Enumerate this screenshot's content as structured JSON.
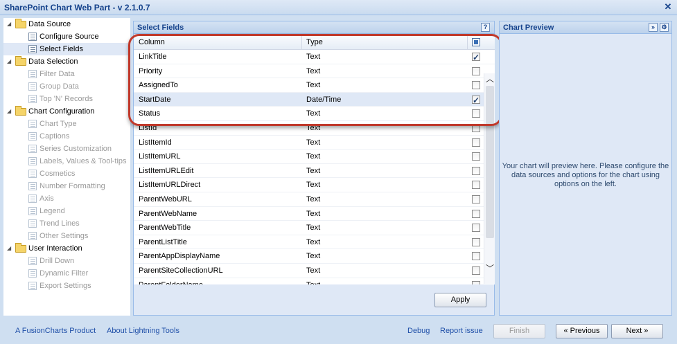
{
  "window": {
    "title": "SharePoint Chart Web Part - v 2.1.0.7"
  },
  "tree": {
    "items": [
      {
        "label": "Data Source",
        "type": "folder",
        "expanded": true,
        "disabled": false,
        "selected": false
      },
      {
        "label": "Configure Source",
        "type": "child",
        "disabled": false,
        "selected": false
      },
      {
        "label": "Select Fields",
        "type": "child",
        "disabled": false,
        "selected": true
      },
      {
        "label": "Data Selection",
        "type": "folder",
        "expanded": true,
        "disabled": false,
        "selected": false
      },
      {
        "label": "Filter Data",
        "type": "child",
        "disabled": true,
        "selected": false
      },
      {
        "label": "Group Data",
        "type": "child",
        "disabled": true,
        "selected": false
      },
      {
        "label": "Top 'N' Records",
        "type": "child",
        "disabled": true,
        "selected": false
      },
      {
        "label": "Chart Configuration",
        "type": "folder",
        "expanded": true,
        "disabled": false,
        "selected": false
      },
      {
        "label": "Chart Type",
        "type": "child",
        "disabled": true,
        "selected": false
      },
      {
        "label": "Captions",
        "type": "child",
        "disabled": true,
        "selected": false
      },
      {
        "label": "Series Customization",
        "type": "child",
        "disabled": true,
        "selected": false
      },
      {
        "label": "Labels, Values & Tool-tips",
        "type": "child",
        "disabled": true,
        "selected": false
      },
      {
        "label": "Cosmetics",
        "type": "child",
        "disabled": true,
        "selected": false
      },
      {
        "label": "Number Formatting",
        "type": "child",
        "disabled": true,
        "selected": false
      },
      {
        "label": "Axis",
        "type": "child",
        "disabled": true,
        "selected": false
      },
      {
        "label": "Legend",
        "type": "child",
        "disabled": true,
        "selected": false
      },
      {
        "label": "Trend Lines",
        "type": "child",
        "disabled": true,
        "selected": false
      },
      {
        "label": "Other Settings",
        "type": "child",
        "disabled": true,
        "selected": false
      },
      {
        "label": "User Interaction",
        "type": "folder",
        "expanded": true,
        "disabled": false,
        "selected": false
      },
      {
        "label": "Drill Down",
        "type": "child",
        "disabled": true,
        "selected": false
      },
      {
        "label": "Dynamic Filter",
        "type": "child",
        "disabled": true,
        "selected": false
      },
      {
        "label": "Export Settings",
        "type": "child",
        "disabled": true,
        "selected": false
      }
    ]
  },
  "select_fields": {
    "title": "Select Fields",
    "help_label": "?",
    "columns": {
      "column": "Column",
      "type": "Type"
    },
    "rows": [
      {
        "column": "LinkTitle",
        "type": "Text",
        "checked": true,
        "selected": false
      },
      {
        "column": "Priority",
        "type": "Text",
        "checked": false,
        "selected": false
      },
      {
        "column": "AssignedTo",
        "type": "Text",
        "checked": false,
        "selected": false
      },
      {
        "column": "StartDate",
        "type": "Date/Time",
        "checked": true,
        "selected": true
      },
      {
        "column": "Status",
        "type": "Text",
        "checked": false,
        "selected": false
      },
      {
        "column": "ListId",
        "type": "Text",
        "checked": false,
        "selected": false
      },
      {
        "column": "ListItemId",
        "type": "Text",
        "checked": false,
        "selected": false
      },
      {
        "column": "ListItemURL",
        "type": "Text",
        "checked": false,
        "selected": false
      },
      {
        "column": "ListItemURLEdit",
        "type": "Text",
        "checked": false,
        "selected": false
      },
      {
        "column": "ListItemURLDirect",
        "type": "Text",
        "checked": false,
        "selected": false
      },
      {
        "column": "ParentWebURL",
        "type": "Text",
        "checked": false,
        "selected": false
      },
      {
        "column": "ParentWebName",
        "type": "Text",
        "checked": false,
        "selected": false
      },
      {
        "column": "ParentWebTitle",
        "type": "Text",
        "checked": false,
        "selected": false
      },
      {
        "column": "ParentListTitle",
        "type": "Text",
        "checked": false,
        "selected": false
      },
      {
        "column": "ParentAppDisplayName",
        "type": "Text",
        "checked": false,
        "selected": false
      },
      {
        "column": "ParentSiteCollectionURL",
        "type": "Text",
        "checked": false,
        "selected": false
      },
      {
        "column": "ParentFolderName",
        "type": "Text",
        "checked": false,
        "selected": false
      }
    ],
    "apply_label": "Apply"
  },
  "chart_preview": {
    "title": "Chart Preview",
    "message": "Your chart will preview here. Please configure the data sources and options for the chart using options on the left."
  },
  "footer": {
    "fusioncharts_link": "A FusionCharts Product",
    "about_link": "About Lightning Tools",
    "debug_link": "Debug",
    "report_link": "Report issue",
    "finish_label": "Finish",
    "previous_label": "« Previous",
    "next_label": "Next »"
  },
  "colors": {
    "accent": "#15428b",
    "highlight": "#c0392b",
    "link": "#1f4fa8"
  }
}
